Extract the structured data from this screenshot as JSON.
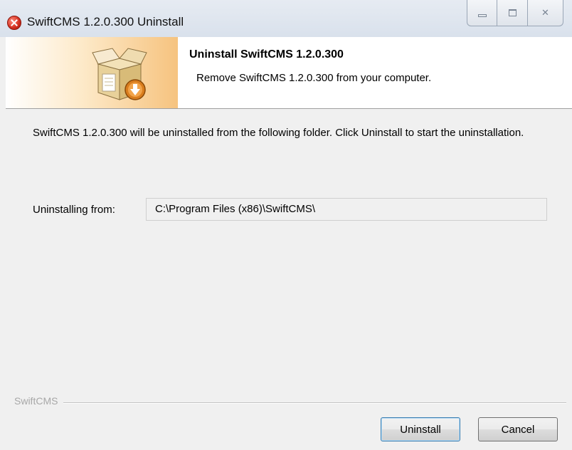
{
  "window": {
    "title": "SwiftCMS 1.2.0.300 Uninstall",
    "icon": "uninstall-app-icon",
    "controls": [
      "minimize-icon",
      "maximize-icon",
      "close-icon"
    ],
    "close_glyph": "✕"
  },
  "header": {
    "title": "Uninstall SwiftCMS 1.2.0.300",
    "subtitle": "Remove SwiftCMS 1.2.0.300 from your computer.",
    "icon": "box-uninstall-icon"
  },
  "body": {
    "intro": "SwiftCMS 1.2.0.300 will be uninstalled from the following folder. Click Uninstall to start the uninstallation.",
    "uninstalling_from_label": "Uninstalling from:",
    "uninstalling_from_value": "C:\\Program Files (x86)\\SwiftCMS\\"
  },
  "footer": {
    "brand": "SwiftCMS",
    "uninstall_label": "Uninstall",
    "cancel_label": "Cancel"
  },
  "colors": {
    "banner_accent": "#f6c37f",
    "window_bg": "#f0f0f0",
    "default_button_border": "#3c7fb1"
  }
}
